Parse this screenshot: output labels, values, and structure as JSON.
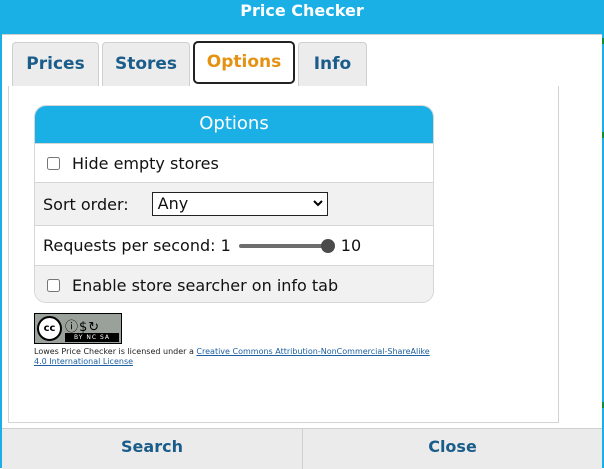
{
  "window": {
    "title": "Price Checker"
  },
  "tabs": [
    {
      "label": "Prices",
      "active": false
    },
    {
      "label": "Stores",
      "active": false
    },
    {
      "label": "Options",
      "active": true
    },
    {
      "label": "Info",
      "active": false
    }
  ],
  "options": {
    "header": "Options",
    "hide_empty_stores": {
      "label": "Hide empty stores",
      "checked": false
    },
    "sort_order": {
      "label": "Sort order:",
      "value": "Any"
    },
    "requests_per_second": {
      "label": "Requests per second: 1",
      "value": 10,
      "min": 1,
      "max": 10,
      "max_label": "10"
    },
    "store_searcher": {
      "label": "Enable store searcher on info tab",
      "checked": false
    }
  },
  "license": {
    "badge": {
      "cc": "cc",
      "bar": "BY NC SA",
      "icon_names": [
        "by-icon",
        "nc-icon",
        "sa-icon"
      ]
    },
    "text_prefix": "Lowes Price Checker is licensed under a ",
    "link_text": "Creative Commons Attribution-NonCommercial-ShareAlike 4.0 International License"
  },
  "footer": {
    "search_label": "Search",
    "close_label": "Close"
  },
  "colors": {
    "accent": "#1ab0e6",
    "active_tab_text": "#e59212",
    "tab_text": "#1b5d8a",
    "link": "#1d5fa0"
  }
}
